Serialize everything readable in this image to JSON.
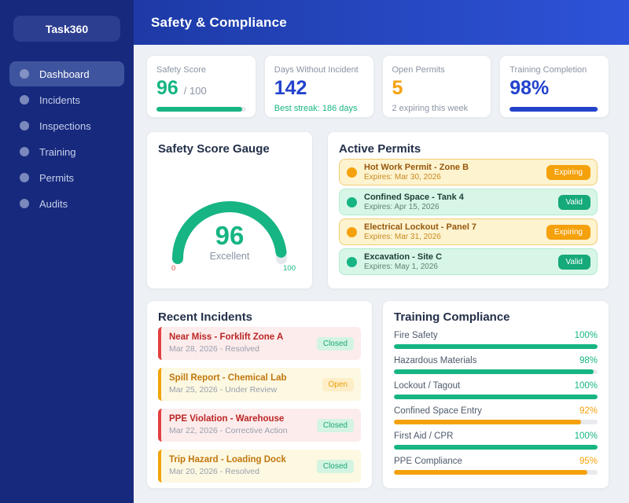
{
  "app": {
    "name": "Task360"
  },
  "header": {
    "title": "Safety & Compliance"
  },
  "sidebar": {
    "items": [
      {
        "label": "Dashboard",
        "state": "active"
      },
      {
        "label": "Incidents",
        "state": "normal"
      },
      {
        "label": "Inspections",
        "state": "normal"
      },
      {
        "label": "Training",
        "state": "normal"
      },
      {
        "label": "Permits",
        "state": "normal"
      },
      {
        "label": "Audits",
        "state": "normal"
      }
    ]
  },
  "stats": [
    {
      "label": "Safety Score",
      "value": "96",
      "suffix": "/ 100",
      "progress": 96
    },
    {
      "label": "Days Without Incident",
      "value": "142",
      "sub": "Best streak: 186 days"
    },
    {
      "label": "Open Permits",
      "value": "5",
      "sub": "2 expiring this week"
    },
    {
      "label": "Training Completion",
      "value": "98%",
      "progress": 98
    }
  ],
  "gauge": {
    "title": "Safety Score Gauge",
    "value": 96,
    "max": 100,
    "min": 0,
    "label": "Excellent"
  },
  "permits": {
    "title": "Active Permits",
    "items": [
      {
        "name": "Hot Work Permit - Zone B",
        "expires": "Expires: Mar 30, 2026",
        "status": "Expiring",
        "tone": "warning"
      },
      {
        "name": "Confined Space - Tank 4",
        "expires": "Expires: Apr 15, 2026",
        "status": "Valid",
        "tone": "success"
      },
      {
        "name": "Electrical Lockout - Panel 7",
        "expires": "Expires: Mar 31, 2026",
        "status": "Expiring",
        "tone": "warning"
      },
      {
        "name": "Excavation - Site C",
        "expires": "Expires: May 1, 2026",
        "status": "Valid",
        "tone": "success"
      }
    ]
  },
  "incidents": {
    "title": "Recent Incidents",
    "items": [
      {
        "name": "Near Miss - Forklift Zone A",
        "meta": "Mar 28, 2026 - Resolved",
        "badge": "Closed",
        "tone": "danger",
        "badge_tone": "success"
      },
      {
        "name": "Spill Report - Chemical Lab",
        "meta": "Mar 25, 2026 - Under Review",
        "badge": "Open",
        "tone": "warning",
        "badge_tone": "warning"
      },
      {
        "name": "PPE Violation - Warehouse",
        "meta": "Mar 22, 2026 - Corrective Action",
        "badge": "Closed",
        "tone": "danger",
        "badge_tone": "success"
      },
      {
        "name": "Trip Hazard - Loading Dock",
        "meta": "Mar 20, 2026 - Resolved",
        "badge": "Closed",
        "tone": "warning",
        "badge_tone": "success"
      }
    ]
  },
  "training": {
    "title": "Training Compliance",
    "items": [
      {
        "label": "Fire Safety",
        "percent": 100,
        "pct_text": "100%",
        "tone": "success"
      },
      {
        "label": "Hazardous Materials",
        "percent": 98,
        "pct_text": "98%",
        "tone": "success"
      },
      {
        "label": "Lockout / Tagout",
        "percent": 100,
        "pct_text": "100%",
        "tone": "success"
      },
      {
        "label": "Confined Space Entry",
        "percent": 92,
        "pct_text": "92%",
        "tone": "warning"
      },
      {
        "label": "First Aid / CPR",
        "percent": 100,
        "pct_text": "100%",
        "tone": "success"
      },
      {
        "label": "PPE Compliance",
        "percent": 95,
        "pct_text": "95%",
        "tone": "warning"
      }
    ]
  },
  "colors": {
    "green": "#16b583",
    "blue": "#2343cd",
    "orange": "#f5a10b",
    "red": "#e0403d",
    "sidebar": "#17297d",
    "header_gradient": [
      "#1d3aa6",
      "#2e53d8"
    ]
  }
}
